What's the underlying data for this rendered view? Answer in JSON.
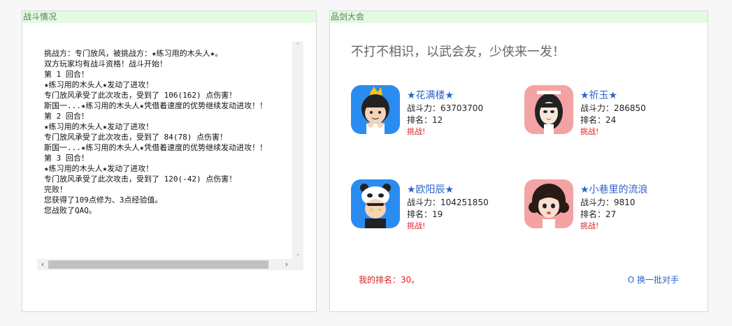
{
  "battle": {
    "header": "战斗情况",
    "log_lines": [
      "挑战方：专门放风，被挑战方：★练习用的木头人★。",
      "双方玩家均有战斗资格！战斗开始！",
      "第 1 回合！",
      "★练习用的木头人★发动了进攻！",
      "专门放风承受了此次攻击，受到了 106(162) 点伤害！",
      "斯国一...★练习用的木头人★凭借着速度的优势继续发动进攻！！",
      "第 2 回合！",
      "★练习用的木头人★发动了进攻！",
      "专门放风承受了此次攻击，受到了 84(78) 点伤害！",
      "斯国一...★练习用的木头人★凭借着速度的优势继续发动进攻！！",
      "第 3 回合！",
      "★练习用的木头人★发动了进攻！",
      "专门放风承受了此次攻击，受到了 120(-42) 点伤害！",
      "完败！",
      "您获得了109点修为、3点经验值。",
      "您战败了QAQ。"
    ]
  },
  "tournament": {
    "header": "品剑大会",
    "slogan": "不打不相识，以武会友，少侠来一发！",
    "opponents": [
      {
        "name": "★花满楼★",
        "power": "战斗力：63703700",
        "rank": "排名：12",
        "challenge": "挑战!",
        "avatar": "boy-crown"
      },
      {
        "name": "★祈玉★",
        "power": "战斗力：286850",
        "rank": "排名：24",
        "challenge": "挑战!",
        "avatar": "girl-bow"
      },
      {
        "name": "★欧阳辰★",
        "power": "战斗力：104251850",
        "rank": "排名：19",
        "challenge": "挑战!",
        "avatar": "boy-panda"
      },
      {
        "name": "★小巷里的流浪",
        "power": "战斗力：9810",
        "rank": "排名：27",
        "challenge": "挑战!",
        "avatar": "girl-curly"
      }
    ],
    "my_rank": "我的排名：30。",
    "refresh": "换一批对手"
  },
  "colors": {
    "accent_blue": "#2b63c9",
    "alert_red": "#e02020",
    "header_green": "#e3fbe0"
  }
}
